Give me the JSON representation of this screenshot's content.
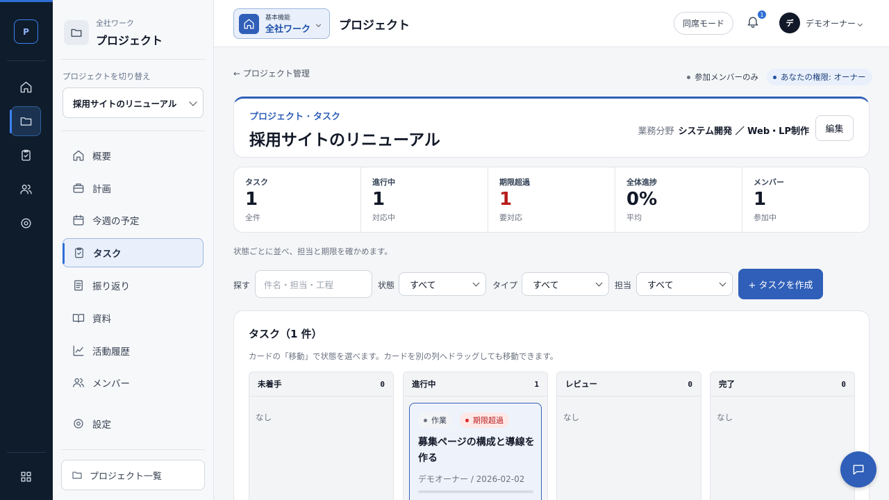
{
  "rail": {
    "logo": "P",
    "items": [
      {
        "icon": "home-icon"
      },
      {
        "icon": "folder-icon",
        "active": true
      },
      {
        "icon": "clipboard-check-icon"
      },
      {
        "icon": "users-icon"
      },
      {
        "icon": "gear-icon"
      }
    ],
    "bottom_icon": "grid-icon"
  },
  "sidebar": {
    "workspace": "全社ワーク",
    "title": "プロジェクト",
    "switch_label": "プロジェクトを切り替え",
    "current_project": "採用サイトのリニューアル",
    "nav": [
      {
        "label": "概要",
        "icon": "home-icon"
      },
      {
        "label": "計画",
        "icon": "briefcase-icon"
      },
      {
        "label": "今週の予定",
        "icon": "calendar-icon"
      },
      {
        "label": "タスク",
        "icon": "clipboard-check-icon",
        "active": true
      },
      {
        "label": "振り返り",
        "icon": "document-icon"
      },
      {
        "label": "資料",
        "icon": "book-icon"
      },
      {
        "label": "活動履歴",
        "icon": "chart-line-icon"
      },
      {
        "label": "メンバー",
        "icon": "users-icon"
      },
      {
        "label": "設定",
        "icon": "gear-icon"
      }
    ],
    "project_list": "プロジェクト一覧"
  },
  "topbar": {
    "workspace_sub": "基本機能",
    "workspace_name": "全社ワーク",
    "title": "プロジェクト",
    "meeting_mode": "同席モード",
    "notification_count": "1",
    "avatar_initial": "デ",
    "user_name": "デモオーナー"
  },
  "main": {
    "back_link": "← プロジェクト管理",
    "pill_members": "参加メンバーのみ",
    "pill_role": "あなたの権限: オーナー",
    "hero": {
      "sub": "プロジェクト · タスク",
      "title": "採用サイトのリニューアル",
      "field_label": "業務分野",
      "field_value": "システム開発 ／ Web・LP制作",
      "edit": "編集"
    },
    "stats": [
      {
        "label": "タスク",
        "value": "1",
        "sub": "全件"
      },
      {
        "label": "進行中",
        "value": "1",
        "sub": "対応中"
      },
      {
        "label": "期限超過",
        "value": "1",
        "sub": "要対応",
        "alert": true
      },
      {
        "label": "全体進捗",
        "value": "0%",
        "sub": "平均"
      },
      {
        "label": "メンバー",
        "value": "1",
        "sub": "参加中"
      }
    ],
    "hint": "状態ごとに並べ、担当と期限を確かめます。",
    "filters": {
      "search_label": "探す",
      "search_placeholder": "件名・担当・工程",
      "status_label": "状態",
      "status_value": "すべて",
      "type_label": "タイプ",
      "type_value": "すべて",
      "assignee_label": "担当",
      "assignee_value": "すべて",
      "create_button": "+ タスクを作成"
    },
    "board": {
      "title": "タスク（1 件）",
      "hint": "カードの「移動」で状態を選べます。カードを別の列へドラッグしても移動できます。",
      "columns": [
        {
          "name": "未着手",
          "count": "0",
          "empty": "なし"
        },
        {
          "name": "進行中",
          "count": "1"
        },
        {
          "name": "レビュー",
          "count": "0",
          "empty": "なし"
        },
        {
          "name": "完了",
          "count": "0",
          "empty": "なし"
        }
      ],
      "card": {
        "type_tag": "作業",
        "status_tag": "期限超過",
        "title": "募集ページの構成と導線を作る",
        "meta": "デモオーナー / 2026-02-02",
        "progress": 0
      }
    }
  },
  "colors": {
    "accent": "#2f5fb8",
    "rail_bg": "#0f1c2b",
    "alert": "#b91c1c"
  }
}
